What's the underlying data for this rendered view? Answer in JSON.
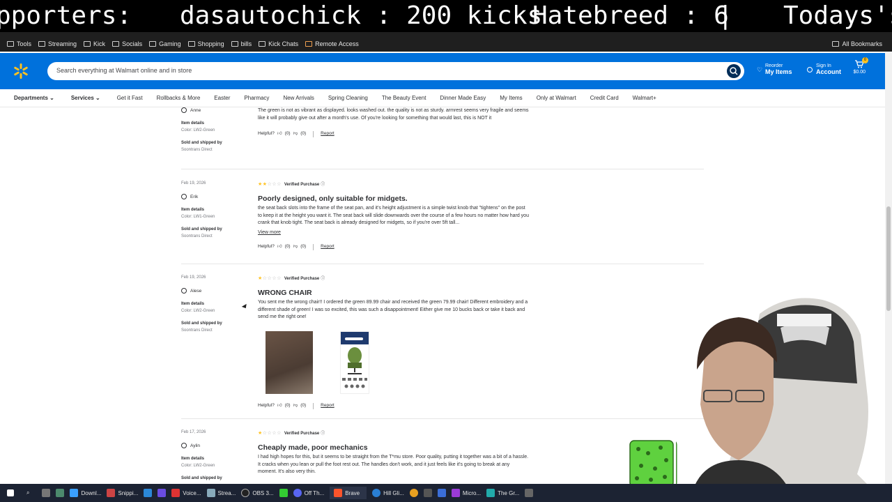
{
  "ticker": {
    "part1": "pporters:",
    "part2": "dasautochick : 200 kicks",
    "part3": "Hatebreed : 6",
    "part4": "|",
    "part5": "Todays's"
  },
  "bookmarks": {
    "items": [
      "Tools",
      "Streaming",
      "Kick",
      "Socials",
      "Gaming",
      "Shopping",
      "bills",
      "Kick Chats",
      "Remote Access"
    ],
    "all": "All Bookmarks"
  },
  "header": {
    "search_placeholder": "Search everything at Walmart online and in store",
    "reorder_small": "Reorder",
    "reorder_big": "My Items",
    "signin_small": "Sign In",
    "signin_big": "Account",
    "cart_count": "0",
    "cart_total": "$0.00"
  },
  "nav": {
    "departments": "Departments",
    "services": "Services",
    "items": [
      "Get it Fast",
      "Rollbacks & More",
      "Easter",
      "Pharmacy",
      "New Arrivals",
      "Spring Cleaning",
      "The Beauty Event",
      "Dinner Made Easy",
      "My Items",
      "Only at Walmart",
      "Credit Card",
      "Walmart+"
    ]
  },
  "common": {
    "item_details": "Item details",
    "sold_shipped": "Sold and shipped by",
    "seller": "Soontrans Direct",
    "verified": "Verified Purchase",
    "helpful": "Helpful?",
    "zero": "(0)",
    "report": "Report",
    "view_more": "View more"
  },
  "reviews": [
    {
      "name": "Anne",
      "color": "Color: LW2-Green",
      "body": "The green is not as vibrant as displayed. looks washed out. the quality is not as sturdy. armrest seems very fragile and seems like it will probably give out after a month's use. Of you're looking for something that would last, this is NOT it"
    },
    {
      "date": "Feb 19, 2026",
      "name": "Erik",
      "color": "Color: LW1-Green",
      "rating": 2,
      "title": "Poorly designed, only suitable for midgets.",
      "body": "the seat back slots into the frame of the seat pan, and it's height adjustment is a simple twist knob that \"tightens\" on the post to keep it at the height you want it. The seat back will slide downwards over the course of a few hours no matter how hard you crank that knob tight. The seat back is already designed for midgets, so if you're over 5ft tall..."
    },
    {
      "date": "Feb 19, 2026",
      "name": "Alese",
      "color": "Color: LW2-Green",
      "rating": 1,
      "title": "WRONG CHAIR",
      "body": "You sent me the wrong chair!! I ordered the green 89.99 chair and received the green 79.99 chair! Different embroidery and a different shade of green! I was so excited, this was such a disappointment! Either give me 10 bucks back or take it back and send me the right one!"
    },
    {
      "date": "Feb 17, 2026",
      "name": "Aylin",
      "color": "Color: LW2-Green",
      "rating": 1,
      "title": "Cheaply made, poor mechanics",
      "body": "I had high hopes for this, but it seems to be straight from the T*mu store. Poor quality, putting it together was a bit of a hassle. It cracks when you lean or pull the foot rest out. The handles don't work, and it just feels like it's going to break at any moment. It's also very thin."
    }
  ],
  "taskbar": {
    "items": [
      "Downl...",
      "Snippi...",
      "Voice...",
      "Strea...",
      "OBS 3...",
      "Off Th...",
      "Brave",
      "Hill Gli...",
      "Micro...",
      "The Gr..."
    ]
  }
}
